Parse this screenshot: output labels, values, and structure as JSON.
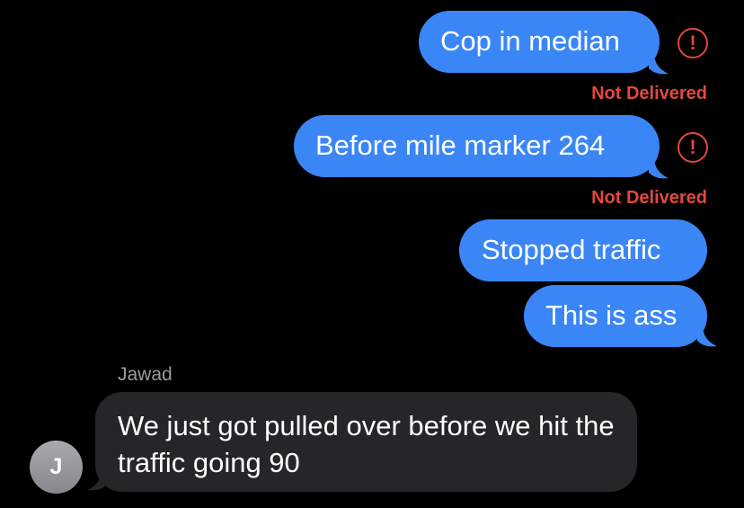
{
  "messages": {
    "m1": {
      "text": "Cop in median",
      "status": "Not Delivered",
      "alert_icon": "!"
    },
    "m2": {
      "text": "Before mile marker 264",
      "status": "Not Delivered",
      "alert_icon": "!"
    },
    "m3": {
      "text": "Stopped traffic"
    },
    "m4": {
      "text": "This is ass"
    },
    "m5": {
      "sender": "Jawad",
      "avatar_initial": "J",
      "text": "We just got pulled over before we hit the traffic going 90"
    }
  },
  "colors": {
    "sent_bubble": "#3a86f7",
    "received_bubble": "#262629",
    "error": "#e2483d",
    "background": "#000000"
  }
}
